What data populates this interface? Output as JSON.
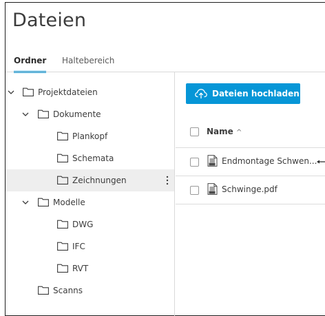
{
  "page": {
    "title": "Dateien"
  },
  "tabs": [
    {
      "label": "Ordner",
      "active": true
    },
    {
      "label": "Haltebereich",
      "active": false
    }
  ],
  "tree": {
    "root": "Projektdateien",
    "documents": "Dokumente",
    "plankopf": "Plankopf",
    "schemata": "Schemata",
    "zeichnungen": "Zeichnungen",
    "modelle": "Modelle",
    "dwg": "DWG",
    "ifc": "IFC",
    "rvt": "RVT",
    "scanns": "Scanns"
  },
  "toolbar": {
    "upload_label": "Dateien hochladen"
  },
  "table": {
    "header_name": "Name",
    "sort_indicator": "^",
    "files": [
      {
        "name": "Endmontage Schwen...",
        "icon": "pdf-icon"
      },
      {
        "name": "Schwinge.pdf",
        "icon": "pdf-icon"
      }
    ]
  },
  "colors": {
    "accent": "#0696d7",
    "text": "#3c3c3c",
    "border": "#d9d9d9",
    "hover": "#eeeeee"
  },
  "icons": [
    "chevron-down-icon",
    "folder-icon",
    "cloud-upload-icon",
    "pdf-icon",
    "kebab-menu-icon",
    "checkbox"
  ]
}
